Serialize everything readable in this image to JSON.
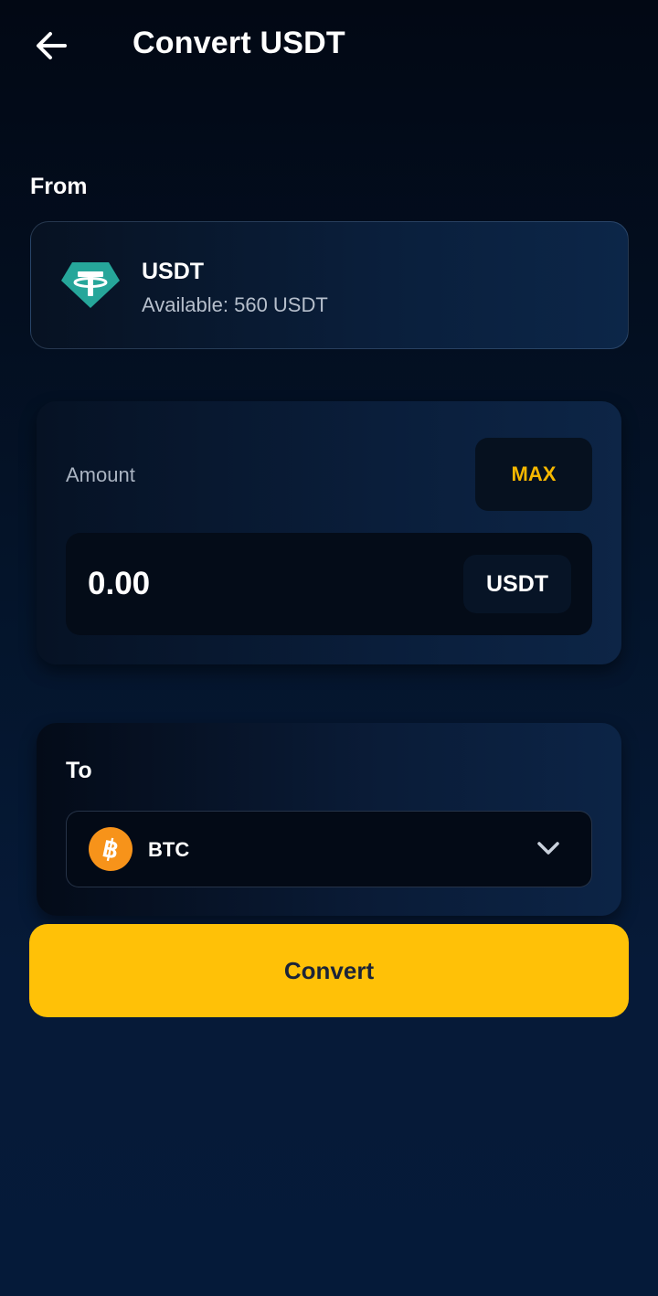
{
  "header": {
    "back_icon": "arrow-left-icon",
    "title": "Convert USDT"
  },
  "from": {
    "label": "From",
    "asset": {
      "icon": "tether-icon",
      "icon_color": "#26a69a",
      "name": "USDT",
      "available": "Available: 560 USDT"
    }
  },
  "amount": {
    "label": "Amount",
    "max_label": "MAX",
    "value": "",
    "placeholder": "0.00",
    "unit": "USDT"
  },
  "to": {
    "label": "To",
    "selected": {
      "icon": "bitcoin-icon",
      "icon_color": "#f7931a",
      "name": "BTC"
    },
    "dropdown_icon": "chevron-down-icon"
  },
  "actions": {
    "convert_label": "Convert"
  },
  "colors": {
    "accent": "#ffc107",
    "max_text": "#f5b800",
    "background": "#04142a"
  }
}
